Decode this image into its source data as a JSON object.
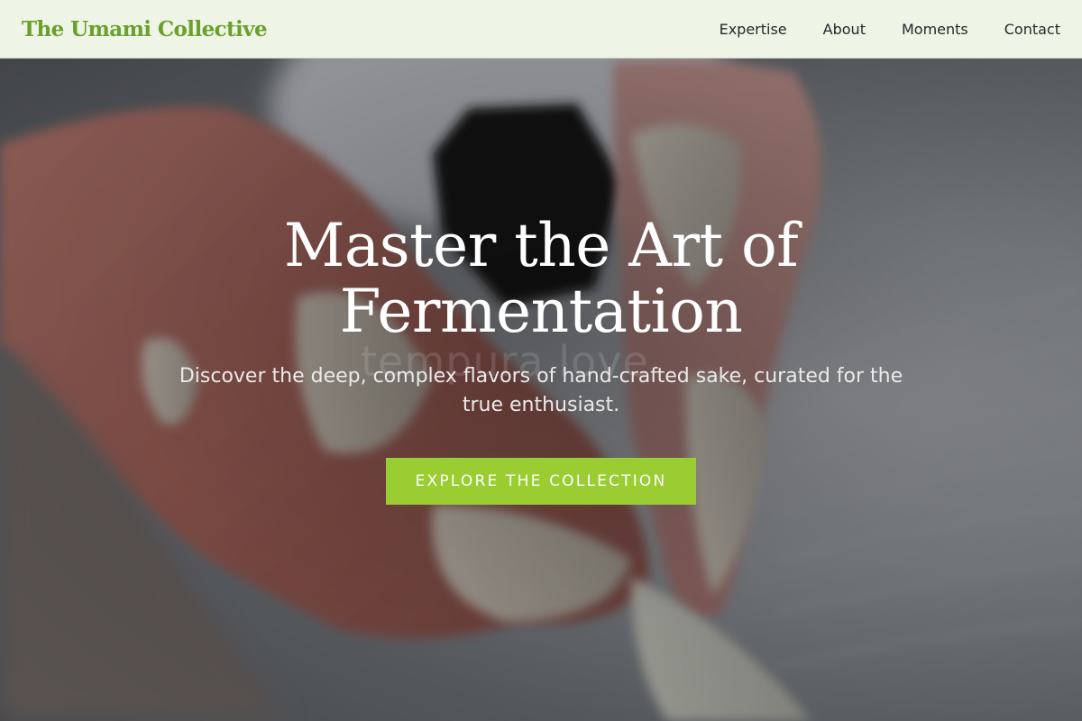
{
  "header": {
    "brand": "The Umami Collective",
    "nav": [
      {
        "label": "Expertise"
      },
      {
        "label": "About"
      },
      {
        "label": "Moments"
      },
      {
        "label": "Contact"
      }
    ]
  },
  "hero": {
    "title": "Master the Art of Fermentation",
    "subtitle": "Discover the deep, complex flavors of hand-crafted sake, curated for the true enthusiast.",
    "cta_label": "EXPLORE THE COLLECTION",
    "watermark_text": "tempura love",
    "background_image": "hands-shaping-clay-photo"
  },
  "colors": {
    "brand": "#6aa02c",
    "header_bg": "#eef4e6",
    "cta_bg": "#9acd32",
    "cta_text": "#ffffff",
    "hero_text": "#ffffff"
  }
}
